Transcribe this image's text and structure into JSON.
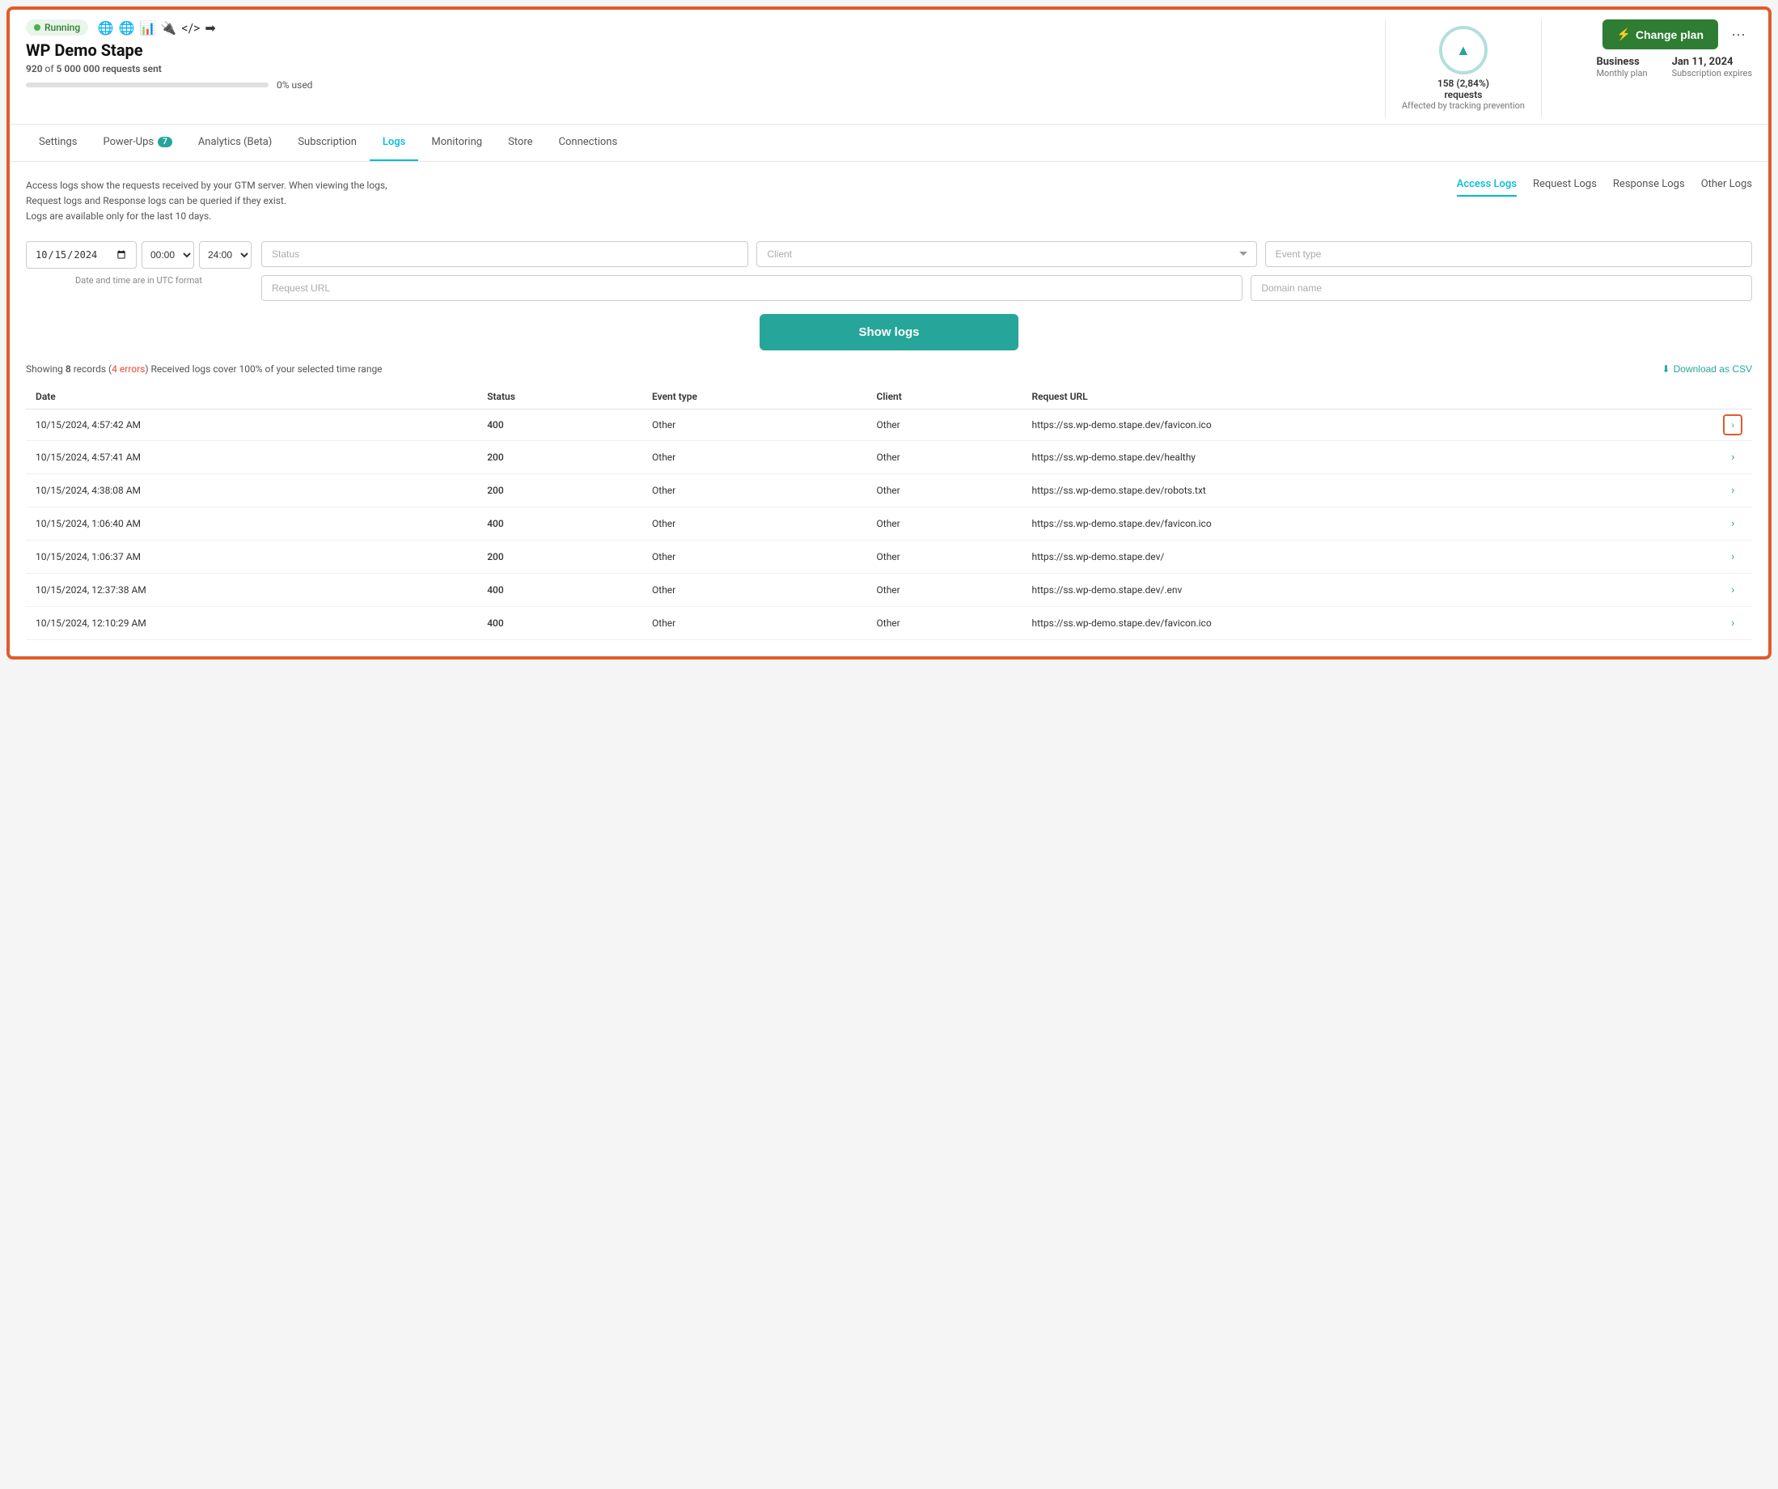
{
  "status": {
    "label": "Running",
    "icon": "🚀"
  },
  "site": {
    "title": "WP Demo Stape",
    "requests_sent_used": "920",
    "requests_sent_total": "5 000 000",
    "requests_label": "requests sent",
    "usage_pct": "0% used"
  },
  "gauge": {
    "value": "158 (2,84%)",
    "label": "requests",
    "sublabel": "Affected by tracking prevention",
    "icon": "▲"
  },
  "plan": {
    "change_btn": "Change plan",
    "name": "Business",
    "type": "Monthly plan",
    "expires_date": "Jan 11, 2024",
    "expires_label": "Subscription expires"
  },
  "nav": {
    "tabs": [
      {
        "label": "Settings",
        "active": false
      },
      {
        "label": "Power-Ups",
        "active": false,
        "badge": "7"
      },
      {
        "label": "Analytics (Beta)",
        "active": false
      },
      {
        "label": "Subscription",
        "active": false
      },
      {
        "label": "Logs",
        "active": true
      },
      {
        "label": "Monitoring",
        "active": false
      },
      {
        "label": "Store",
        "active": false
      },
      {
        "label": "Connections",
        "active": false
      }
    ]
  },
  "logs": {
    "description_line1": "Access logs show the requests received by your GTM server. When viewing the logs,",
    "description_line2": "Request logs and Response logs can be queried if they exist.",
    "description_line3": "Logs are available only for the last 10 days.",
    "type_tabs": [
      {
        "label": "Access Logs",
        "active": true
      },
      {
        "label": "Request Logs",
        "active": false
      },
      {
        "label": "Response Logs",
        "active": false
      },
      {
        "label": "Other Logs",
        "active": false
      }
    ]
  },
  "filters": {
    "date": "15.10.2024",
    "time_from": "00:00",
    "time_to": "24:00",
    "utc_note": "Date and time are in UTC format",
    "status_placeholder": "Status",
    "client_placeholder": "Client",
    "event_type_placeholder": "Event type",
    "request_url_placeholder": "Request URL",
    "domain_name_placeholder": "Domain name",
    "show_logs_btn": "Show logs"
  },
  "results": {
    "count": "8",
    "errors": "4 errors",
    "coverage": "Received logs cover 100% of your selected time range",
    "download_btn": "Download as CSV"
  },
  "table": {
    "columns": [
      "Date",
      "Status",
      "Event type",
      "Client",
      "Request URL"
    ],
    "rows": [
      {
        "date": "10/15/2024, 4:57:42 AM",
        "status": "400",
        "status_type": "error",
        "event_type": "Other",
        "client": "Other",
        "url": "https://ss.wp-demo.stape.dev/favicon.ico",
        "highlighted": true
      },
      {
        "date": "10/15/2024, 4:57:41 AM",
        "status": "200",
        "status_type": "success",
        "event_type": "Other",
        "client": "Other",
        "url": "https://ss.wp-demo.stape.dev/healthy",
        "highlighted": false
      },
      {
        "date": "10/15/2024, 4:38:08 AM",
        "status": "200",
        "status_type": "success",
        "event_type": "Other",
        "client": "Other",
        "url": "https://ss.wp-demo.stape.dev/robots.txt",
        "highlighted": false
      },
      {
        "date": "10/15/2024, 1:06:40 AM",
        "status": "400",
        "status_type": "error",
        "event_type": "Other",
        "client": "Other",
        "url": "https://ss.wp-demo.stape.dev/favicon.ico",
        "highlighted": false
      },
      {
        "date": "10/15/2024, 1:06:37 AM",
        "status": "200",
        "status_type": "success",
        "event_type": "Other",
        "client": "Other",
        "url": "https://ss.wp-demo.stape.dev/",
        "highlighted": false
      },
      {
        "date": "10/15/2024, 12:37:38 AM",
        "status": "400",
        "status_type": "error",
        "event_type": "Other",
        "client": "Other",
        "url": "https://ss.wp-demo.stape.dev/.env",
        "highlighted": false
      },
      {
        "date": "10/15/2024, 12:10:29 AM",
        "status": "400",
        "status_type": "error",
        "event_type": "Other",
        "client": "Other",
        "url": "https://ss.wp-demo.stape.dev/favicon.ico",
        "highlighted": false
      }
    ]
  }
}
